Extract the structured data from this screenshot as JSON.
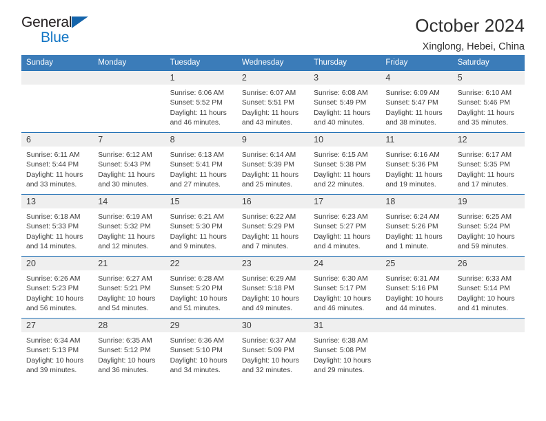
{
  "brand": {
    "name_top": "General",
    "name_bottom": "Blue",
    "flag_icon": "blue-triangle-flag"
  },
  "header": {
    "title": "October 2024",
    "subtitle": "Xinglong, Hebei, China"
  },
  "colors": {
    "header_blue": "#3b7cb9",
    "rule_blue": "#1f6fb5",
    "daynum_band": "#efefef",
    "logo_blue": "#1175c4",
    "text": "#3c3c3c"
  },
  "weekday_headers": [
    "Sunday",
    "Monday",
    "Tuesday",
    "Wednesday",
    "Thursday",
    "Friday",
    "Saturday"
  ],
  "weeks": [
    [
      {
        "day": "",
        "sunrise": "",
        "sunset": "",
        "daylight1": "",
        "daylight2": "",
        "empty": true
      },
      {
        "day": "",
        "sunrise": "",
        "sunset": "",
        "daylight1": "",
        "daylight2": "",
        "empty": true
      },
      {
        "day": "1",
        "sunrise": "Sunrise: 6:06 AM",
        "sunset": "Sunset: 5:52 PM",
        "daylight1": "Daylight: 11 hours",
        "daylight2": "and 46 minutes."
      },
      {
        "day": "2",
        "sunrise": "Sunrise: 6:07 AM",
        "sunset": "Sunset: 5:51 PM",
        "daylight1": "Daylight: 11 hours",
        "daylight2": "and 43 minutes."
      },
      {
        "day": "3",
        "sunrise": "Sunrise: 6:08 AM",
        "sunset": "Sunset: 5:49 PM",
        "daylight1": "Daylight: 11 hours",
        "daylight2": "and 40 minutes."
      },
      {
        "day": "4",
        "sunrise": "Sunrise: 6:09 AM",
        "sunset": "Sunset: 5:47 PM",
        "daylight1": "Daylight: 11 hours",
        "daylight2": "and 38 minutes."
      },
      {
        "day": "5",
        "sunrise": "Sunrise: 6:10 AM",
        "sunset": "Sunset: 5:46 PM",
        "daylight1": "Daylight: 11 hours",
        "daylight2": "and 35 minutes."
      }
    ],
    [
      {
        "day": "6",
        "sunrise": "Sunrise: 6:11 AM",
        "sunset": "Sunset: 5:44 PM",
        "daylight1": "Daylight: 11 hours",
        "daylight2": "and 33 minutes."
      },
      {
        "day": "7",
        "sunrise": "Sunrise: 6:12 AM",
        "sunset": "Sunset: 5:43 PM",
        "daylight1": "Daylight: 11 hours",
        "daylight2": "and 30 minutes."
      },
      {
        "day": "8",
        "sunrise": "Sunrise: 6:13 AM",
        "sunset": "Sunset: 5:41 PM",
        "daylight1": "Daylight: 11 hours",
        "daylight2": "and 27 minutes."
      },
      {
        "day": "9",
        "sunrise": "Sunrise: 6:14 AM",
        "sunset": "Sunset: 5:39 PM",
        "daylight1": "Daylight: 11 hours",
        "daylight2": "and 25 minutes."
      },
      {
        "day": "10",
        "sunrise": "Sunrise: 6:15 AM",
        "sunset": "Sunset: 5:38 PM",
        "daylight1": "Daylight: 11 hours",
        "daylight2": "and 22 minutes."
      },
      {
        "day": "11",
        "sunrise": "Sunrise: 6:16 AM",
        "sunset": "Sunset: 5:36 PM",
        "daylight1": "Daylight: 11 hours",
        "daylight2": "and 19 minutes."
      },
      {
        "day": "12",
        "sunrise": "Sunrise: 6:17 AM",
        "sunset": "Sunset: 5:35 PM",
        "daylight1": "Daylight: 11 hours",
        "daylight2": "and 17 minutes."
      }
    ],
    [
      {
        "day": "13",
        "sunrise": "Sunrise: 6:18 AM",
        "sunset": "Sunset: 5:33 PM",
        "daylight1": "Daylight: 11 hours",
        "daylight2": "and 14 minutes."
      },
      {
        "day": "14",
        "sunrise": "Sunrise: 6:19 AM",
        "sunset": "Sunset: 5:32 PM",
        "daylight1": "Daylight: 11 hours",
        "daylight2": "and 12 minutes."
      },
      {
        "day": "15",
        "sunrise": "Sunrise: 6:21 AM",
        "sunset": "Sunset: 5:30 PM",
        "daylight1": "Daylight: 11 hours",
        "daylight2": "and 9 minutes."
      },
      {
        "day": "16",
        "sunrise": "Sunrise: 6:22 AM",
        "sunset": "Sunset: 5:29 PM",
        "daylight1": "Daylight: 11 hours",
        "daylight2": "and 7 minutes."
      },
      {
        "day": "17",
        "sunrise": "Sunrise: 6:23 AM",
        "sunset": "Sunset: 5:27 PM",
        "daylight1": "Daylight: 11 hours",
        "daylight2": "and 4 minutes."
      },
      {
        "day": "18",
        "sunrise": "Sunrise: 6:24 AM",
        "sunset": "Sunset: 5:26 PM",
        "daylight1": "Daylight: 11 hours",
        "daylight2": "and 1 minute."
      },
      {
        "day": "19",
        "sunrise": "Sunrise: 6:25 AM",
        "sunset": "Sunset: 5:24 PM",
        "daylight1": "Daylight: 10 hours",
        "daylight2": "and 59 minutes."
      }
    ],
    [
      {
        "day": "20",
        "sunrise": "Sunrise: 6:26 AM",
        "sunset": "Sunset: 5:23 PM",
        "daylight1": "Daylight: 10 hours",
        "daylight2": "and 56 minutes."
      },
      {
        "day": "21",
        "sunrise": "Sunrise: 6:27 AM",
        "sunset": "Sunset: 5:21 PM",
        "daylight1": "Daylight: 10 hours",
        "daylight2": "and 54 minutes."
      },
      {
        "day": "22",
        "sunrise": "Sunrise: 6:28 AM",
        "sunset": "Sunset: 5:20 PM",
        "daylight1": "Daylight: 10 hours",
        "daylight2": "and 51 minutes."
      },
      {
        "day": "23",
        "sunrise": "Sunrise: 6:29 AM",
        "sunset": "Sunset: 5:18 PM",
        "daylight1": "Daylight: 10 hours",
        "daylight2": "and 49 minutes."
      },
      {
        "day": "24",
        "sunrise": "Sunrise: 6:30 AM",
        "sunset": "Sunset: 5:17 PM",
        "daylight1": "Daylight: 10 hours",
        "daylight2": "and 46 minutes."
      },
      {
        "day": "25",
        "sunrise": "Sunrise: 6:31 AM",
        "sunset": "Sunset: 5:16 PM",
        "daylight1": "Daylight: 10 hours",
        "daylight2": "and 44 minutes."
      },
      {
        "day": "26",
        "sunrise": "Sunrise: 6:33 AM",
        "sunset": "Sunset: 5:14 PM",
        "daylight1": "Daylight: 10 hours",
        "daylight2": "and 41 minutes."
      }
    ],
    [
      {
        "day": "27",
        "sunrise": "Sunrise: 6:34 AM",
        "sunset": "Sunset: 5:13 PM",
        "daylight1": "Daylight: 10 hours",
        "daylight2": "and 39 minutes."
      },
      {
        "day": "28",
        "sunrise": "Sunrise: 6:35 AM",
        "sunset": "Sunset: 5:12 PM",
        "daylight1": "Daylight: 10 hours",
        "daylight2": "and 36 minutes."
      },
      {
        "day": "29",
        "sunrise": "Sunrise: 6:36 AM",
        "sunset": "Sunset: 5:10 PM",
        "daylight1": "Daylight: 10 hours",
        "daylight2": "and 34 minutes."
      },
      {
        "day": "30",
        "sunrise": "Sunrise: 6:37 AM",
        "sunset": "Sunset: 5:09 PM",
        "daylight1": "Daylight: 10 hours",
        "daylight2": "and 32 minutes."
      },
      {
        "day": "31",
        "sunrise": "Sunrise: 6:38 AM",
        "sunset": "Sunset: 5:08 PM",
        "daylight1": "Daylight: 10 hours",
        "daylight2": "and 29 minutes."
      },
      {
        "day": "",
        "sunrise": "",
        "sunset": "",
        "daylight1": "",
        "daylight2": "",
        "empty": true
      },
      {
        "day": "",
        "sunrise": "",
        "sunset": "",
        "daylight1": "",
        "daylight2": "",
        "empty": true
      }
    ]
  ]
}
